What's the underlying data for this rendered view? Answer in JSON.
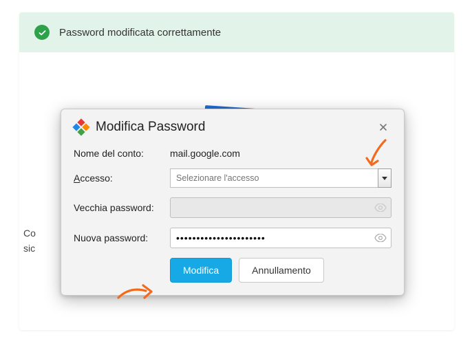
{
  "banner": {
    "message": "Password modificata correttamente"
  },
  "cut_text": {
    "line1": "Co",
    "line2": "sic"
  },
  "dialog": {
    "title": "Modifica Password",
    "account_label": "Nome del conto:",
    "account_value": "mail.google.com",
    "access_label_underline": "A",
    "access_label_rest": "ccesso:",
    "access_placeholder": "Selezionare l'accesso",
    "old_pw_label": "Vecchia password:",
    "old_pw_value": "",
    "new_pw_label": "Nuova password:",
    "new_pw_value": "••••••••••••••••••••••",
    "submit": "Modifica",
    "cancel": "Annullamento"
  }
}
